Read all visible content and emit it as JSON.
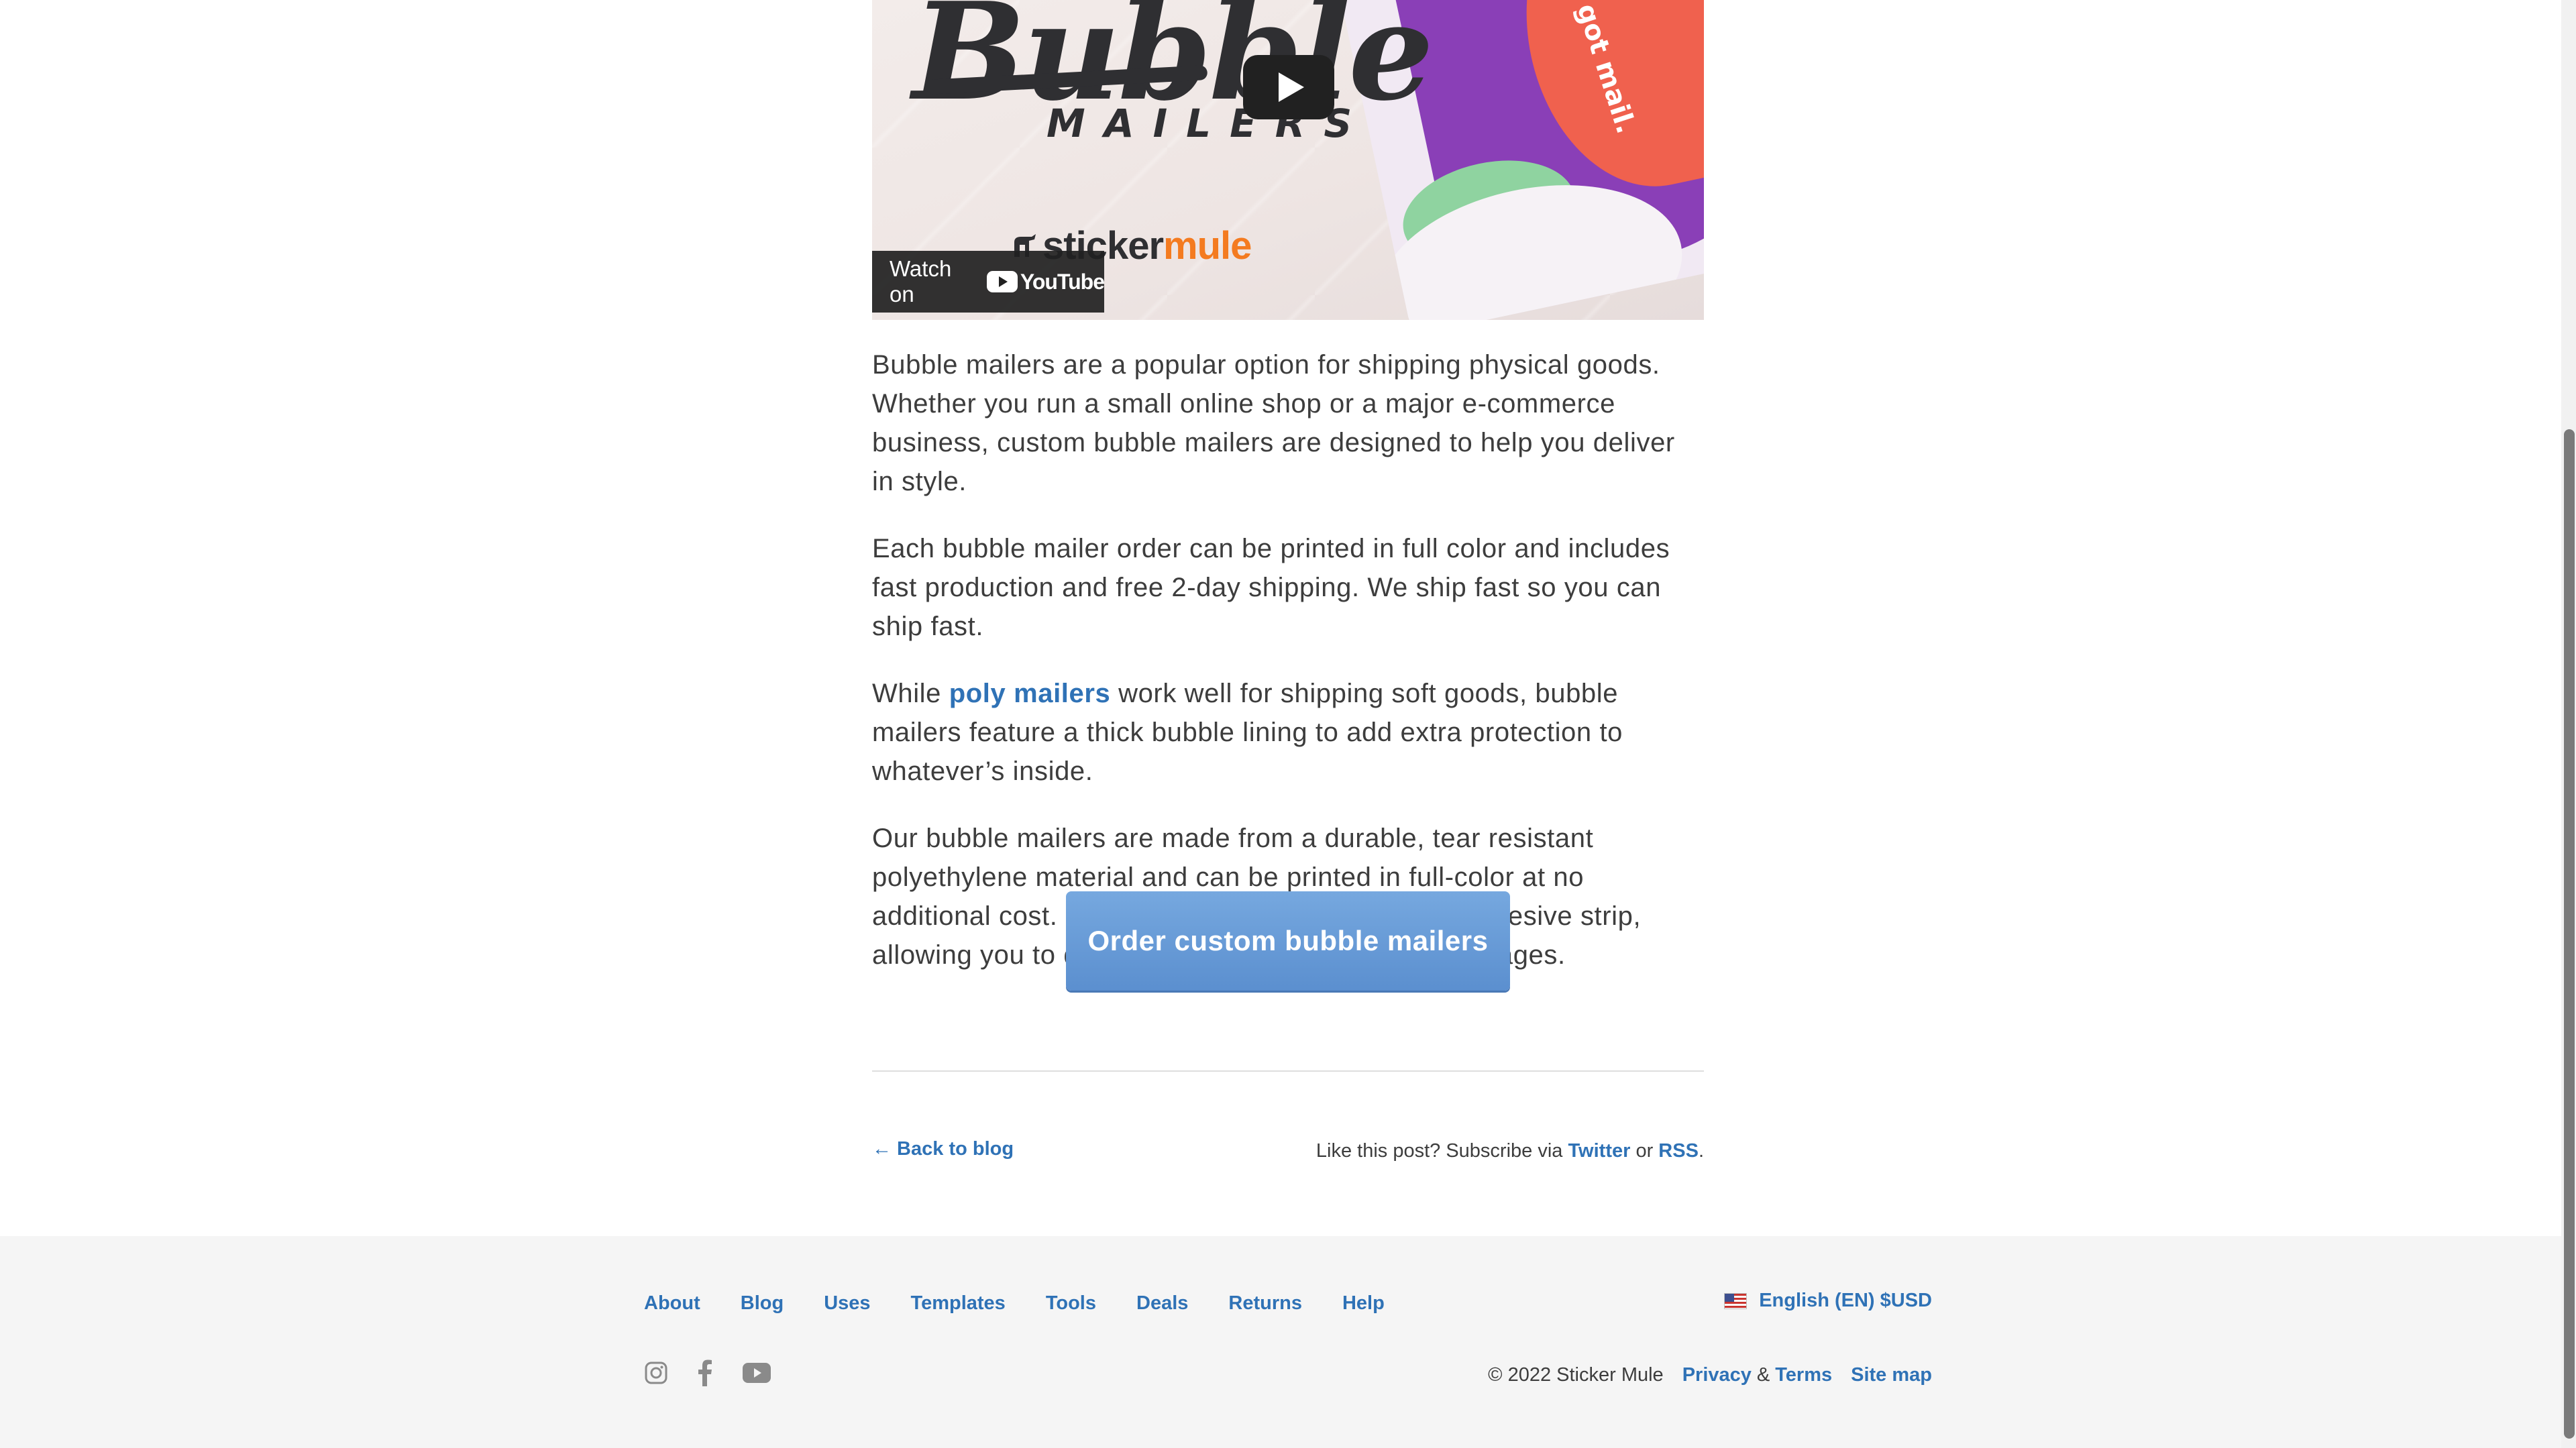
{
  "video": {
    "brand_script": "Bubble",
    "brand_sub": "MAILERS",
    "bag_text": "got mail.",
    "channel_brand_a": "sticker",
    "channel_brand_b": "mule",
    "watch_label": "Watch on",
    "youtube_word": "YouTube"
  },
  "article": {
    "p1": "Bubble mailers are a popular option for shipping physical goods. Whether you run a small online shop or a major e-commerce business, custom bubble mailers are designed to help you deliver in style.",
    "p2": "Each bubble mailer order can be printed in full color and includes fast production and free 2-day shipping. We ship fast so you can ship fast.",
    "p3_before": "While ",
    "p3_link": "poly mailers",
    "p3_after": " work well for shipping soft goods, bubble mailers feature a thick bubble lining to add extra protection to whatever’s inside.",
    "p4": "Our bubble mailers are made from a durable, tear resistant polyethylene material and can be printed in full-color at no additional cost. Each mailer also features a self-adhesive strip, allowing you to quickly fill, seal, and ship your packages."
  },
  "cta": {
    "label": "Order custom bubble mailers"
  },
  "post_footer": {
    "back_label": "← Back to blog",
    "subscribe_text": "Like this post? Subscribe via ",
    "twitter": "Twitter",
    "or": " or ",
    "rss": "RSS",
    "period": "."
  },
  "footer": {
    "nav": [
      "About",
      "Blog",
      "Uses",
      "Templates",
      "Tools",
      "Deals",
      "Returns",
      "Help"
    ],
    "language": "English (EN) $USD",
    "copyright": "© 2022 Sticker Mule",
    "privacy": "Privacy",
    "amp": "&",
    "terms": "Terms",
    "sitemap": "Site map",
    "social_icons": [
      "instagram-icon",
      "facebook-icon",
      "youtube-icon"
    ]
  },
  "colors": {
    "link": "#2f72b6",
    "text": "#3d3d3d",
    "cta": "#6b9cd8",
    "footer_bg": "#f5f5f5",
    "brand_orange": "#f47b20"
  }
}
